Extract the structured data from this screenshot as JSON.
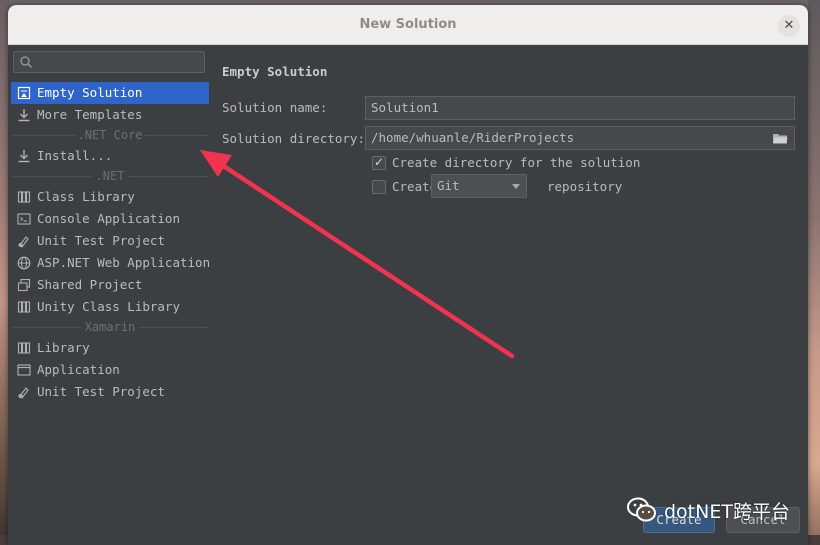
{
  "window": {
    "title": "New Solution"
  },
  "sidebar": {
    "search_placeholder": "",
    "items_top": [
      {
        "label": "Empty Solution",
        "icon": "empty-solution-icon",
        "selected": true
      },
      {
        "label": "More Templates",
        "icon": "download-icon",
        "selected": false
      }
    ],
    "section_netcore": "NET Core",
    "netcore_items": [
      {
        "label": "Install...",
        "icon": "download-icon"
      }
    ],
    "section_net": ".NET",
    "net_items": [
      {
        "label": "Class Library",
        "icon": "library-icon"
      },
      {
        "label": "Console Application",
        "icon": "console-icon"
      },
      {
        "label": "Unit Test Project",
        "icon": "unit-test-icon"
      },
      {
        "label": "ASP.NET Web Application",
        "icon": "globe-icon"
      },
      {
        "label": "Shared Project",
        "icon": "shared-project-icon"
      },
      {
        "label": "Unity Class Library",
        "icon": "unity-icon"
      }
    ],
    "section_xamarin": "Xamarin",
    "xamarin_items": [
      {
        "label": "Library",
        "icon": "library-icon"
      },
      {
        "label": "Application",
        "icon": "window-icon"
      },
      {
        "label": "Unit Test Project",
        "icon": "unit-test-icon"
      }
    ]
  },
  "main": {
    "title": "Empty Solution",
    "solution_name_label": "Solution name:",
    "solution_name_value": "Solution1",
    "solution_directory_label": "Solution directory:",
    "solution_directory_value": "/home/whuanle/RiderProjects",
    "create_directory_label": "Create directory for the solution",
    "create_directory_checked": true,
    "create_repo_label": "Create",
    "repo_type": "Git",
    "repository_label": "repository",
    "create_repo_checked": false
  },
  "buttons": {
    "create": "Create",
    "cancel": "Cancel"
  },
  "watermark": {
    "text": "dotNET跨平台"
  },
  "colors": {
    "selection": "#2f65ca",
    "arrow": "#f2334f",
    "dialog_bg": "#3c3f41"
  }
}
